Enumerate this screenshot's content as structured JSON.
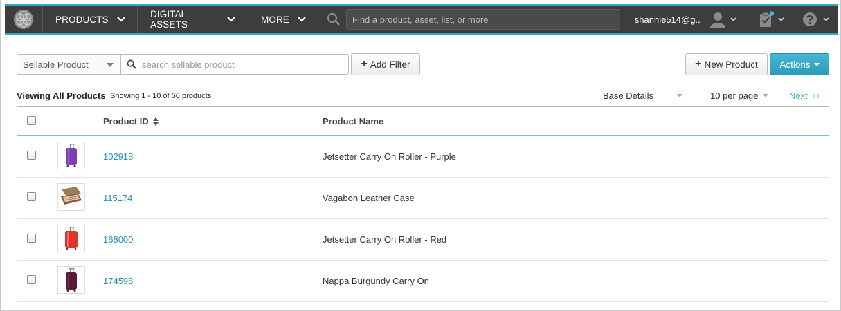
{
  "nav": {
    "products_label": "PRODUCTS",
    "digital_assets_label": "DIGITAL ASSETS",
    "more_label": "MORE",
    "search_placeholder": "Find a product, asset, list, or more",
    "user_email": "shannie514@g...",
    "icons": [
      "logo-flower-icon",
      "search-icon",
      "user-icon",
      "task-clipboard-icon",
      "help-icon",
      "chevron-down-icon"
    ],
    "accent_color": "#2fa8c4"
  },
  "filters": {
    "type_selected": "Sellable Product",
    "search_placeholder": "search sellable product",
    "add_filter_label": "Add Filter"
  },
  "toolbar": {
    "new_product_label": "New Product",
    "actions_label": "Actions"
  },
  "list_info": {
    "viewing_label": "Viewing All Products",
    "showing_text": "Showing 1 - 10 of 56 products",
    "view_selected": "Base Details",
    "per_page_selected": "10 per page",
    "next_label": "Next"
  },
  "table": {
    "columns": [
      "Product ID",
      "Product Name"
    ],
    "rows": [
      {
        "id": "102918",
        "name": "Jetsetter Carry On Roller - Purple",
        "thumb_color": "#7b3fb5"
      },
      {
        "id": "115174",
        "name": "Vagabon Leather Case",
        "thumb_color": "#8a5a3a"
      },
      {
        "id": "168000",
        "name": "Jetsetter Carry On Roller - Red",
        "thumb_color": "#e0342b"
      },
      {
        "id": "174598",
        "name": "Nappa Burgundy Carry On",
        "thumb_color": "#5a1a33"
      }
    ]
  }
}
